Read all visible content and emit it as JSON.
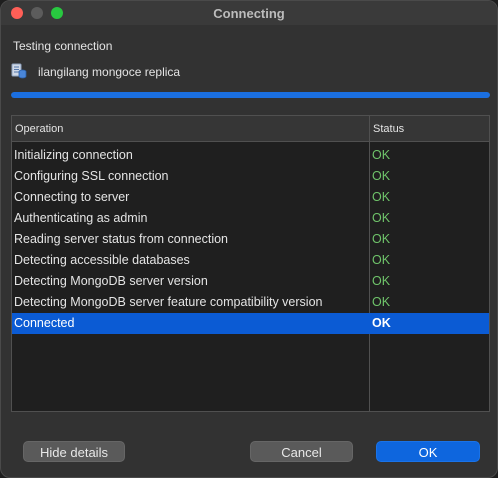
{
  "window": {
    "title": "Connecting"
  },
  "heading": "Testing connection",
  "connection": {
    "name": "ilangilang mongoce replica",
    "icon": "database-document-icon"
  },
  "progress": 1.0,
  "table": {
    "columns": [
      "Operation",
      "Status"
    ],
    "rows": [
      {
        "operation": "Initializing connection",
        "status": "OK"
      },
      {
        "operation": "Configuring SSL connection",
        "status": "OK"
      },
      {
        "operation": "Connecting to server",
        "status": "OK"
      },
      {
        "operation": "Authenticating as admin",
        "status": "OK"
      },
      {
        "operation": "Reading server status from connection",
        "status": "OK"
      },
      {
        "operation": "Detecting accessible databases",
        "status": "OK"
      },
      {
        "operation": "Detecting MongoDB server version",
        "status": "OK"
      },
      {
        "operation": "Detecting MongoDB server feature compatibility version",
        "status": "OK"
      },
      {
        "operation": "Connected",
        "status": "OK",
        "selected": true
      }
    ]
  },
  "buttons": {
    "hide_details": "Hide details",
    "cancel": "Cancel",
    "ok": "OK"
  },
  "colors": {
    "accent": "#0e66de",
    "status_ok": "#6fc46a",
    "selection": "#0b5bd4"
  }
}
